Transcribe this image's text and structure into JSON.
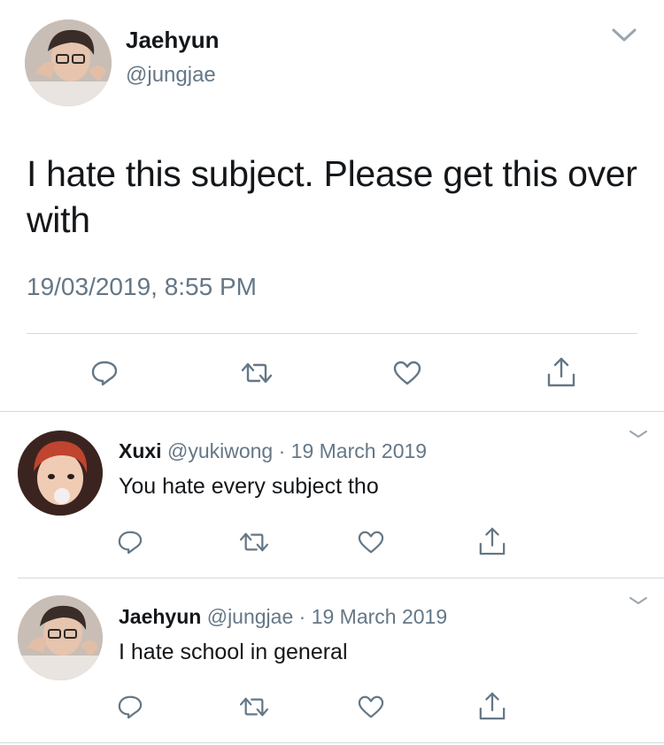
{
  "main_tweet": {
    "author_name": "Jaehyun",
    "author_handle": "@jungjae",
    "text": "I hate this subject. Please get this over with",
    "timestamp": "19/03/2019, 8:55 PM",
    "icons": [
      "reply-icon",
      "retweet-icon",
      "like-icon",
      "share-icon"
    ]
  },
  "replies": [
    {
      "author_name": "Xuxi",
      "author_handle": "@yukiwong",
      "separator": "·",
      "date": "19 March 2019",
      "text": "You hate every subject tho"
    },
    {
      "author_name": "Jaehyun",
      "author_handle": "@jungjae",
      "separator": "·",
      "date": "19 March 2019",
      "text": "I hate school in general"
    }
  ],
  "colors": {
    "text_primary": "#14171a",
    "text_secondary": "#657786",
    "icon": "#657786",
    "divider": "#d4d9dd"
  }
}
